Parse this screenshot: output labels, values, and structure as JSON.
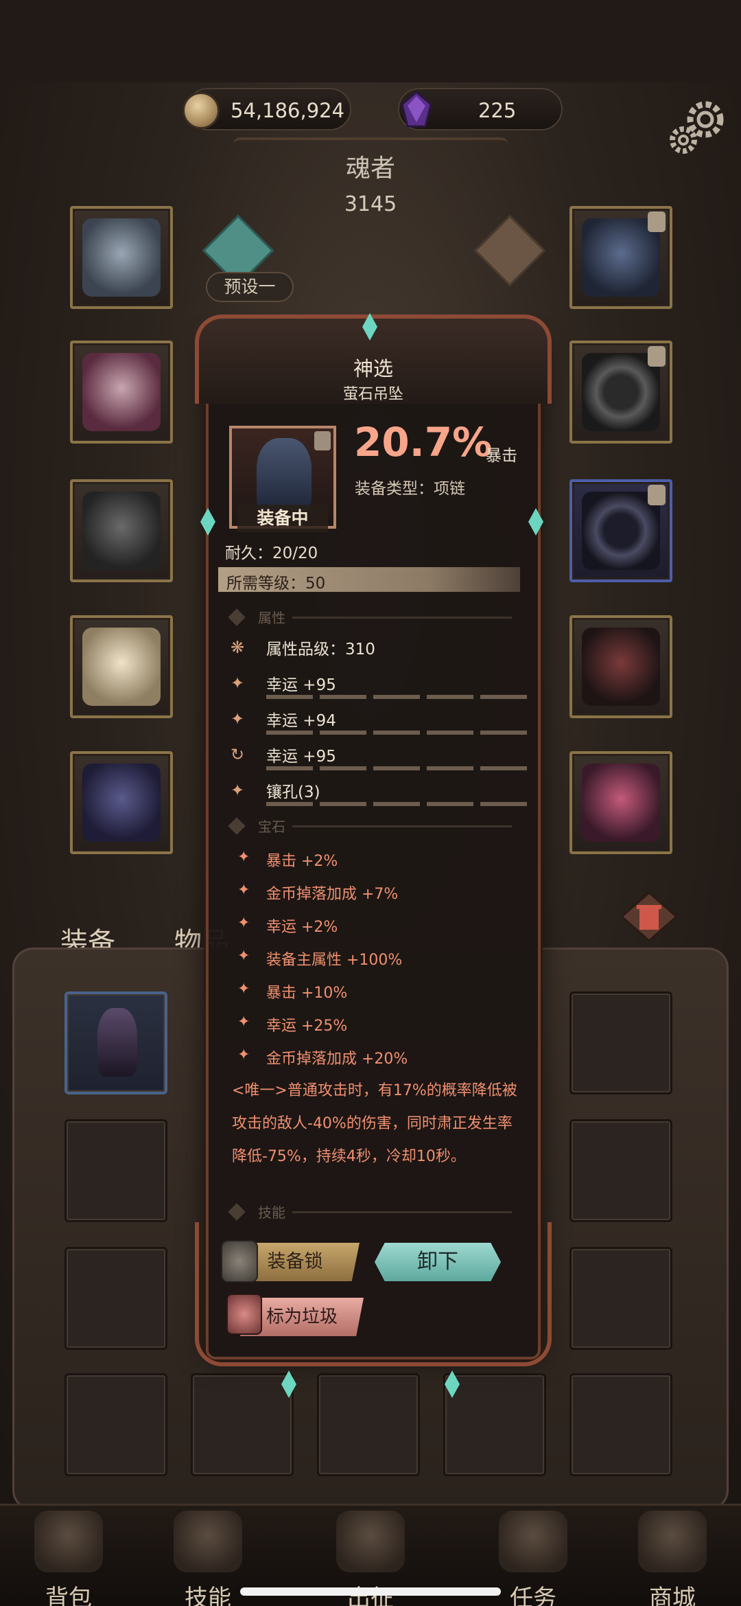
{
  "currency": {
    "coins": "54,186,924",
    "gems": "225"
  },
  "hero": {
    "name": "魂者",
    "power": "3145",
    "preset_label": "预设一"
  },
  "popup": {
    "rank": "神选",
    "item_name": "萤石吊坠",
    "equipped_label": "装备中",
    "main_stat_value": "20.7%",
    "main_stat_name": "暴击",
    "equip_type": "装备类型：项链",
    "durability": "耐久：20/20",
    "required_level": "所需等级：50",
    "section_attributes": "属性",
    "section_gems": "宝石",
    "section_skills": "技能",
    "attributes": [
      {
        "icon": "quality-icon",
        "text": "属性品级：310"
      },
      {
        "icon": "luck-icon",
        "text": "幸运 +95"
      },
      {
        "icon": "luck-icon",
        "text": "幸运 +94"
      },
      {
        "icon": "reroll-icon",
        "text": "幸运 +95"
      },
      {
        "icon": "socket-icon",
        "text": "镶孔(3)"
      }
    ],
    "gems": [
      "暴击 +2%",
      "金币掉落加成 +7%",
      "幸运 +2%",
      "装备主属性 +100%",
      "暴击 +10%",
      "幸运 +25%",
      "金币掉落加成 +20%"
    ],
    "unique_effect": "<唯一>普通攻击时，有17%的概率降低被攻击的敌人-40%的伤害，同时肃正发生率降低-75%，持续4秒，冷却10秒。",
    "buttons": {
      "lock": "装备锁",
      "unequip": "卸下",
      "junk": "标为垃圾"
    }
  },
  "bag": {
    "tab_equip": "装备",
    "tab_item": "物品"
  },
  "nav": [
    {
      "label": "背包",
      "icon": "backpack-icon"
    },
    {
      "label": "技能",
      "icon": "skill-book-icon"
    },
    {
      "label": "出征",
      "icon": "sword-icon"
    },
    {
      "label": "任务",
      "icon": "quest-scroll-icon"
    },
    {
      "label": "商城",
      "icon": "shop-crown-icon"
    }
  ],
  "colors": {
    "accent_teal": "#6cd6c0",
    "stat_red": "#f7a58a",
    "gem_text": "#f09070",
    "frame_copper": "#8d4a35"
  }
}
